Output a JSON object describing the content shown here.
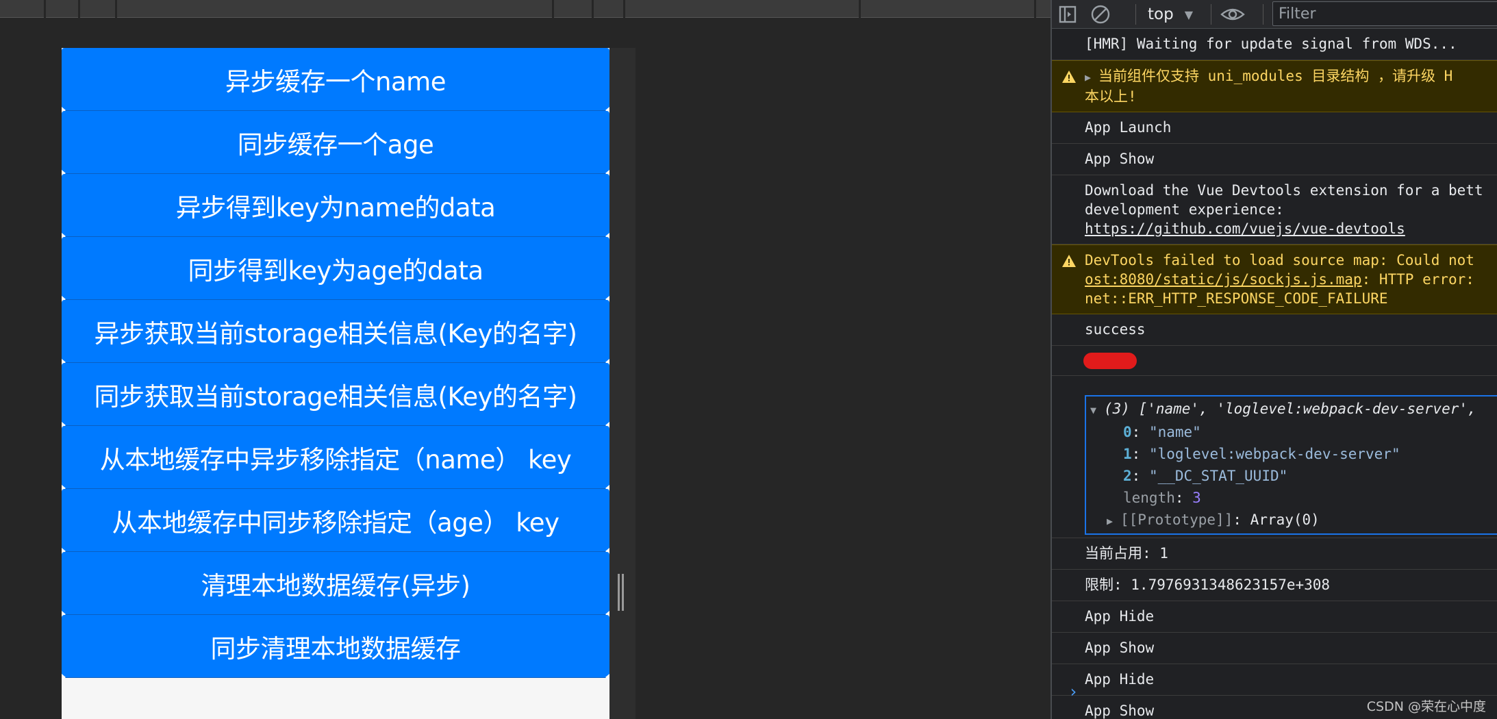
{
  "app": {
    "buttons": [
      "异步缓存一个name",
      "同步缓存一个age",
      "异步得到key为name的data",
      "同步得到key为age的data",
      "异步获取当前storage相关信息(Key的名字)",
      "同步获取当前storage相关信息(Key的名字)",
      "从本地缓存中异步移除指定（name） key",
      "从本地缓存中同步移除指定（age） key",
      "清理本地数据缓存(异步)",
      "同步清理本地数据缓存"
    ],
    "accent_color": "#007aff"
  },
  "console": {
    "toolbar": {
      "context": "top",
      "filter_placeholder": "Filter",
      "icons": [
        "sidebar-toggle-icon",
        "clear-console-icon",
        "eye-icon"
      ]
    },
    "messages": {
      "hmr": "[HMR] Waiting for update signal from WDS...",
      "warn1_line1": "当前组件仅支持 uni_modules 目录结构 ，请升级 H",
      "warn1_line2": "本以上!",
      "launch": "App Launch",
      "show1": "App Show",
      "vue_line1": "Download the Vue Devtools extension for a bett",
      "vue_line2": "development experience:",
      "vue_link": "https://github.com/vuejs/vue-devtools",
      "warn2_line1": "DevTools failed to load source map: Could not",
      "warn2_link": "ost:8080/static/js/sockjs.js.map",
      "warn2_line2_rest": ": HTTP error:",
      "warn2_line3": "net::ERR_HTTP_RESPONSE_CODE_FAILURE",
      "success": "success",
      "array_summary": "(3) ['name', 'loglevel:webpack-dev-server',",
      "array_items": [
        {
          "index": "0",
          "value": "\"name\""
        },
        {
          "index": "1",
          "value": "\"loglevel:webpack-dev-server\""
        },
        {
          "index": "2",
          "value": "\"__DC_STAT_UUID\""
        }
      ],
      "length_key": "length",
      "length_value": "3",
      "prototype_key": "[[Prototype]]",
      "prototype_value": "Array(0)",
      "current_size": "当前占用: 1",
      "limit": "限制: 1.7976931348623157e+308",
      "hide1": "App Hide",
      "show2": "App Show",
      "hide2": "App Hide",
      "show3": "App Show"
    },
    "warn_color": "#fdd663",
    "prompt_symbol": "›"
  },
  "watermark": "CSDN @荣在心中度"
}
